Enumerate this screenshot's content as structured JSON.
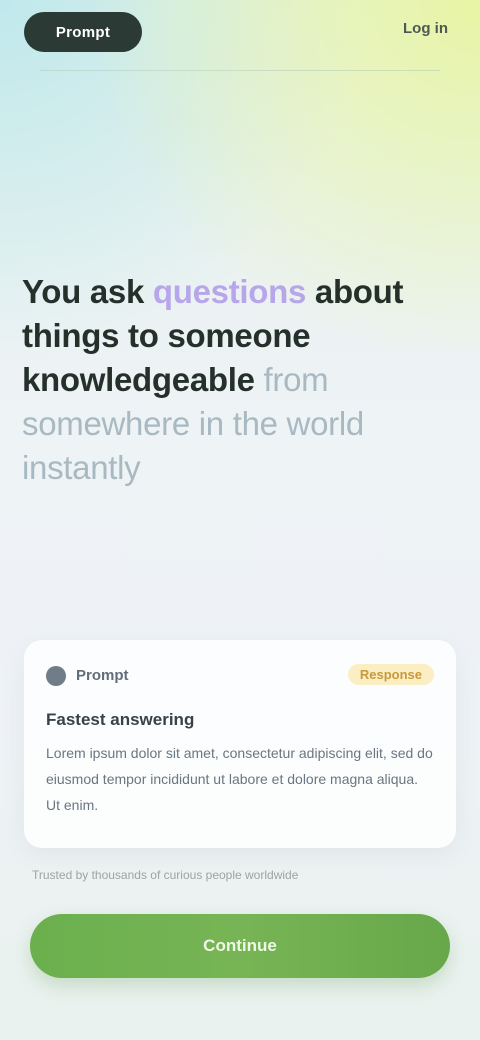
{
  "topbar": {
    "logo": "Prompt",
    "login": "Log in"
  },
  "hero": {
    "line1_a": "You ask ",
    "line1_accent": "questions",
    "line1_b": " about",
    "line2": "things to someone",
    "line3_a": "knowledgeable",
    "line3_muted": " from",
    "line4": "somewhere in the world",
    "line5": "instantly"
  },
  "card": {
    "brand": "Prompt",
    "badge": "Response",
    "title": "Fastest answering",
    "body": "Lorem ipsum dolor sit amet, consectetur adipiscing elit, sed do eiusmod tempor incididunt ut labore et dolore magna aliqua. Ut enim."
  },
  "footnote": "Trusted by thousands of curious people worldwide",
  "cta": {
    "label": "Continue"
  }
}
